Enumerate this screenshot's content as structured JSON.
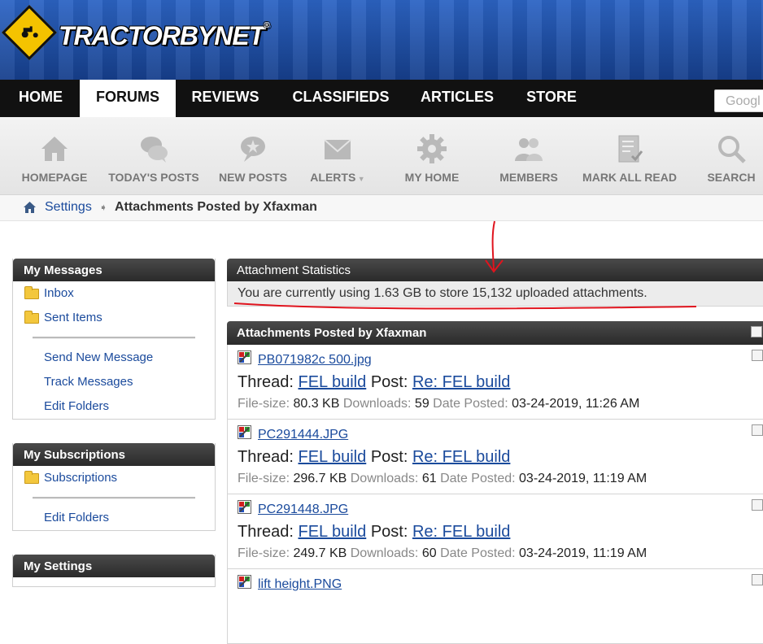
{
  "site": {
    "logo_text": "TRACTORBYNET",
    "logo_tm": "®"
  },
  "mainnav": {
    "tabs": [
      {
        "label": "HOME"
      },
      {
        "label": "FORUMS"
      },
      {
        "label": "REVIEWS"
      },
      {
        "label": "CLASSIFIEDS"
      },
      {
        "label": "ARTICLES"
      },
      {
        "label": "STORE"
      }
    ],
    "active_tab": "FORUMS",
    "search_placeholder": "Googl"
  },
  "subnav": {
    "items": [
      {
        "label": "HOMEPAGE",
        "icon": "house-icon"
      },
      {
        "label": "TODAY'S POSTS",
        "icon": "chat-bubbles-icon"
      },
      {
        "label": "NEW POSTS",
        "icon": "star-bubble-icon"
      },
      {
        "label": "ALERTS",
        "icon": "envelope-icon"
      },
      {
        "label": "MY HOME",
        "icon": "gear-icon"
      },
      {
        "label": "MEMBERS",
        "icon": "people-icon"
      },
      {
        "label": "MARK ALL READ",
        "icon": "checklist-icon"
      },
      {
        "label": "SEARCH",
        "icon": "magnifier-icon"
      }
    ]
  },
  "breadcrumb": {
    "link": "Settings",
    "current": "Attachments Posted by Xfaxman"
  },
  "sidebar": {
    "messages": {
      "title": "My Messages",
      "folders": [
        "Inbox",
        "Sent Items"
      ],
      "links": [
        "Send New Message",
        "Track Messages",
        "Edit Folders"
      ]
    },
    "subscriptions": {
      "title": "My Subscriptions",
      "folders": [
        "Subscriptions"
      ],
      "links": [
        "Edit Folders"
      ]
    },
    "settings": {
      "title": "My Settings"
    }
  },
  "stats": {
    "title": "Attachment Statistics",
    "text": "You are currently using 1.63 GB to store 15,132 uploaded attachments."
  },
  "attachments": {
    "title": "Attachments Posted by Xfaxman",
    "labels": {
      "thread": "Thread:",
      "post": "Post:",
      "filesize": "File-size:",
      "downloads": "Downloads:",
      "date_posted": "Date Posted:"
    },
    "items": [
      {
        "file": "PB071982c 500.jpg",
        "thread": "FEL build",
        "post": "Re: FEL build",
        "size": "80.3 KB",
        "downloads": "59",
        "date": "03-24-2019, 11:26 AM"
      },
      {
        "file": "PC291444.JPG",
        "thread": "FEL build",
        "post": "Re: FEL build",
        "size": "296.7 KB",
        "downloads": "61",
        "date": "03-24-2019, 11:19 AM"
      },
      {
        "file": "PC291448.JPG",
        "thread": "FEL build",
        "post": "Re: FEL build",
        "size": "249.7 KB",
        "downloads": "60",
        "date": "03-24-2019, 11:19 AM"
      },
      {
        "file": "lift height.PNG"
      }
    ]
  },
  "colors": {
    "link": "#1a4a9c",
    "annotation": "#e0141e",
    "header_dark": "#2a2a2a",
    "nav": "#111111"
  }
}
